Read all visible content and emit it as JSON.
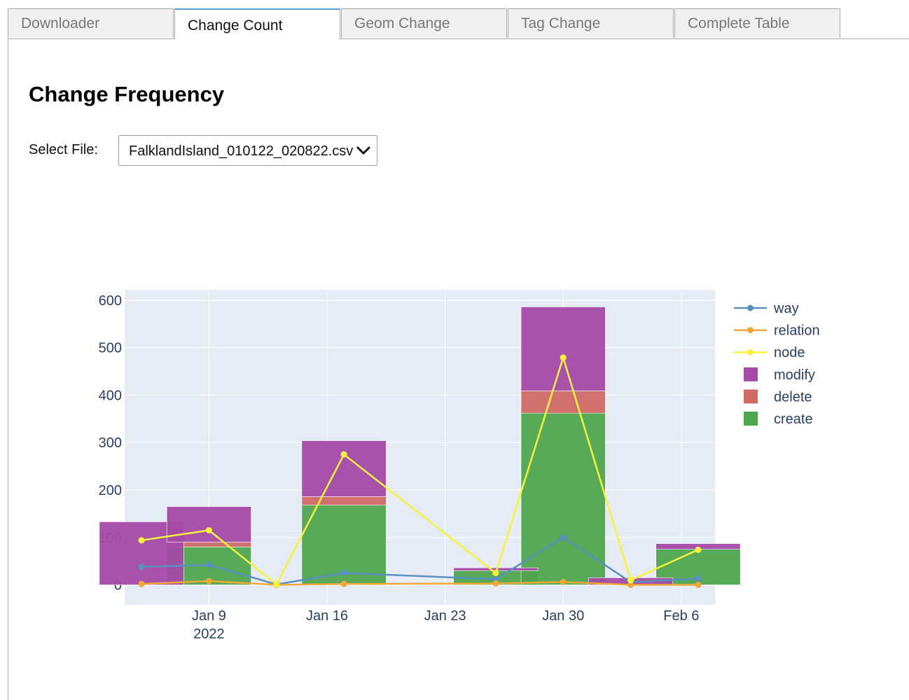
{
  "tabs": [
    {
      "label": "Downloader",
      "active": false
    },
    {
      "label": "Change Count",
      "active": true
    },
    {
      "label": "Geom Change",
      "active": false
    },
    {
      "label": "Tag Change",
      "active": false
    },
    {
      "label": "Complete Table",
      "active": false
    }
  ],
  "page": {
    "title": "Change Frequency",
    "select_label": "Select File:",
    "select_value": "FalklandIsland_010122_020822.csv"
  },
  "colors": {
    "way": "#5b8fbd",
    "relation": "#f2a838",
    "node": "#f8f33a",
    "modify": "#a54aa8",
    "delete": "#cf6a66",
    "create": "#4ea74f",
    "plot_bg": "#e5ecf6",
    "grid": "#ffffff",
    "tab_accent": "#5d9cd3"
  },
  "chart_data": {
    "type": "bar",
    "barmode": "stack",
    "title": "",
    "x_ticks": [
      {
        "label": "Jan 9",
        "sub": "2022",
        "date": "2022-01-09"
      },
      {
        "label": "Jan 16",
        "sub": "",
        "date": "2022-01-16"
      },
      {
        "label": "Jan 23",
        "sub": "",
        "date": "2022-01-23"
      },
      {
        "label": "Jan 30",
        "sub": "",
        "date": "2022-01-30"
      },
      {
        "label": "Feb 6",
        "sub": "",
        "date": "2022-02-06"
      }
    ],
    "y_ticks": [
      0,
      100,
      200,
      300,
      400,
      500,
      600
    ],
    "xlim": [
      "2022-01-04",
      "2022-02-08"
    ],
    "ylim": [
      -42,
      622
    ],
    "grid": true,
    "legend_position": "right",
    "x": [
      "2022-01-05",
      "2022-01-09",
      "2022-01-13",
      "2022-01-17",
      "2022-01-26",
      "2022-01-30",
      "2022-02-03",
      "2022-02-07"
    ],
    "bars": [
      {
        "name": "create",
        "values": [
          0,
          80,
          0,
          168,
          30,
          362,
          0,
          75
        ]
      },
      {
        "name": "delete",
        "values": [
          0,
          10,
          0,
          18,
          0,
          47,
          0,
          0
        ]
      },
      {
        "name": "modify",
        "values": [
          133,
          75,
          0,
          118,
          6,
          177,
          15,
          12
        ]
      }
    ],
    "lines": [
      {
        "name": "way",
        "values": [
          38,
          42,
          1,
          25,
          12,
          100,
          6,
          13
        ]
      },
      {
        "name": "relation",
        "values": [
          2,
          8,
          0,
          2,
          3,
          6,
          0,
          0
        ]
      },
      {
        "name": "node",
        "values": [
          94,
          115,
          1,
          275,
          25,
          479,
          10,
          74
        ]
      }
    ],
    "legend": [
      "way",
      "relation",
      "node",
      "modify",
      "delete",
      "create"
    ]
  }
}
